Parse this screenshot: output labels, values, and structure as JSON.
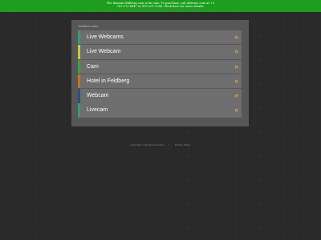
{
  "banner": {
    "text": "The domain feldberg.com is for sale. To purchase, call Afternic.com at +1 781-373-6847 or 855-201-2286. Click here for more details."
  },
  "panel": {
    "title": "Related Links"
  },
  "links": [
    {
      "label": "Live Webcams",
      "color": "#3a9a7a"
    },
    {
      "label": "Live Webcam",
      "color": "#c8c83a"
    },
    {
      "label": "Cam",
      "color": "#3aa050"
    },
    {
      "label": "Hotel in Feldberg",
      "color": "#c8702a"
    },
    {
      "label": "Webcam",
      "color": "#2f4f7a"
    },
    {
      "label": "Livecam",
      "color": "#3a9a7a"
    }
  ],
  "arrow_glyph": "»",
  "footer": {
    "copyright": "Copyright ©  All rights reserved",
    "separator": "|",
    "privacy": "Privacy Policy"
  }
}
